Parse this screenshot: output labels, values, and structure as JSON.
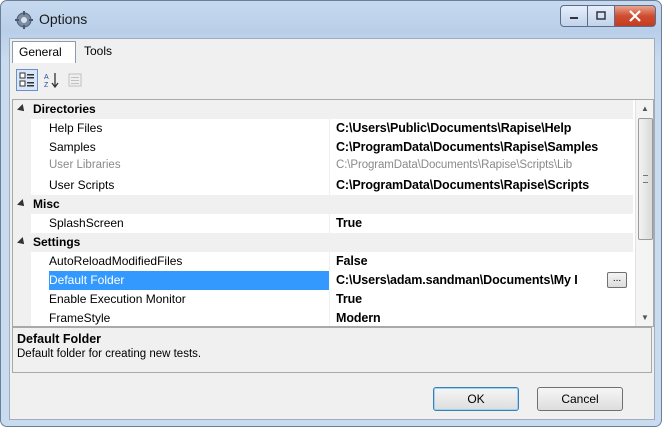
{
  "window": {
    "title": "Options"
  },
  "tabs": [
    {
      "label": "General",
      "active": true
    },
    {
      "label": "Tools",
      "active": false
    }
  ],
  "toolbar": {
    "categorized_icon": "categorized-icon",
    "alphabetical_icon": "sort-az-icon",
    "property_pages_icon": "property-pages-icon"
  },
  "grid": {
    "directories": {
      "label": "Directories",
      "help_files": {
        "name": "Help Files",
        "value": "C:\\Users\\Public\\Documents\\Rapise\\Help"
      },
      "samples": {
        "name": "Samples",
        "value": "C:\\ProgramData\\Documents\\Rapise\\Samples"
      },
      "user_libraries": {
        "name": "User Libraries",
        "value": "C:\\ProgramData\\Documents\\Rapise\\Scripts\\Lib"
      },
      "user_scripts": {
        "name": "User Scripts",
        "value": "C:\\ProgramData\\Documents\\Rapise\\Scripts"
      }
    },
    "misc": {
      "label": "Misc",
      "splash": {
        "name": "SplashScreen",
        "value": "True"
      }
    },
    "settings": {
      "label": "Settings",
      "auto_reload": {
        "name": "AutoReloadModifiedFiles",
        "value": "False"
      },
      "default_folder": {
        "name": "Default Folder",
        "value": "C:\\Users\\adam.sandman\\Documents\\My I"
      },
      "exec_monitor": {
        "name": "Enable Execution Monitor",
        "value": "True"
      },
      "frame_style": {
        "name": "FrameStyle",
        "value": "Modern"
      }
    },
    "ellipsis_label": "..."
  },
  "description": {
    "title": "Default Folder",
    "text": "Default folder for creating new tests."
  },
  "buttons": {
    "ok": "OK",
    "cancel": "Cancel"
  },
  "colors": {
    "selection": "#3399ff",
    "close_button": "#c43c22"
  }
}
